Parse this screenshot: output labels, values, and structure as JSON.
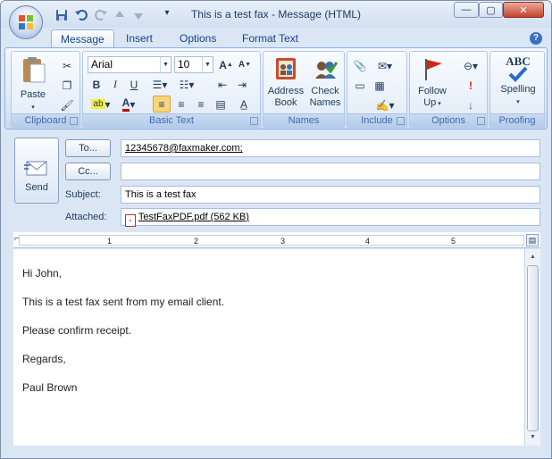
{
  "window": {
    "title": "This is a test fax - Message (HTML)",
    "minimize_label": "—",
    "maximize_label": "▢",
    "close_label": "✕"
  },
  "tabs": [
    "Message",
    "Insert",
    "Options",
    "Format Text"
  ],
  "help_label": "?",
  "ribbon": {
    "clipboard": {
      "label": "Clipboard",
      "paste": "Paste"
    },
    "basic_text": {
      "label": "Basic Text",
      "font": "Arial",
      "size": "10",
      "bold": "B",
      "italic": "I",
      "underline": "U"
    },
    "names": {
      "label": "Names",
      "address_book_1": "Address",
      "address_book_2": "Book",
      "check_names_1": "Check",
      "check_names_2": "Names"
    },
    "include": {
      "label": "Include"
    },
    "options": {
      "label": "Options",
      "follow_up_1": "Follow",
      "follow_up_2": "Up"
    },
    "proofing": {
      "label": "Proofing",
      "spelling": "Spelling",
      "abc": "ABC"
    }
  },
  "compose": {
    "send": "Send",
    "to_button": "To...",
    "cc_button": "Cc...",
    "to_value": "12345678@faxmaker.com;",
    "cc_value": "",
    "subject_label": "Subject:",
    "subject_value": "This is a test fax",
    "attached_label": "Attached:",
    "attachment": "TestFaxPDF.pdf (562 KB)"
  },
  "ruler_numbers": [
    "1",
    "2",
    "3",
    "4",
    "5"
  ],
  "body": {
    "paragraphs": [
      "Hi John,",
      "This is a test fax sent from my email client.",
      "Please confirm receipt.",
      "Regards,",
      "Paul Brown"
    ]
  },
  "colors": {
    "accent": "#15428b",
    "ribbon_border": "#8db2e3",
    "close_red": "#c3442a"
  }
}
